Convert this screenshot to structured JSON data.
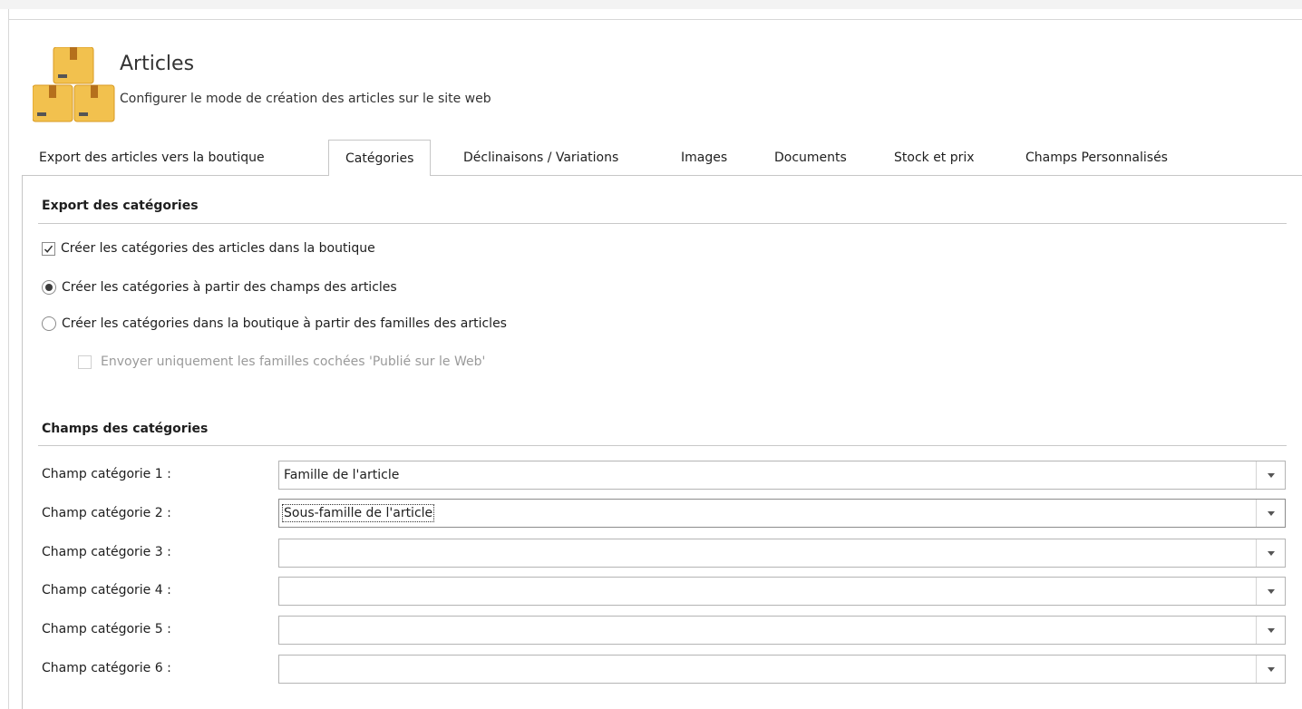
{
  "header": {
    "title": "Articles",
    "subtitle": "Configurer le mode de création des articles sur le site web",
    "icon": "boxes-icon"
  },
  "tabs": [
    {
      "label": "Export des articles vers la boutique",
      "active": false
    },
    {
      "label": "Catégories",
      "active": true
    },
    {
      "label": "Déclinaisons / Variations",
      "active": false
    },
    {
      "label": "Images",
      "active": false
    },
    {
      "label": "Documents",
      "active": false
    },
    {
      "label": "Stock et prix",
      "active": false
    },
    {
      "label": "Champs Personnalisés",
      "active": false
    }
  ],
  "export_section": {
    "title": "Export des catégories",
    "create_categories": {
      "label": "Créer les catégories des articles dans la boutique",
      "checked": true
    },
    "mode_fields": {
      "label": "Créer les catégories à partir des champs des articles",
      "selected": true
    },
    "mode_families": {
      "label": "Créer les catégories dans la boutique à partir des familles des articles",
      "selected": false
    },
    "only_published": {
      "label": "Envoyer uniquement les familles cochées 'Publié sur le Web'",
      "checked": false,
      "enabled": false
    }
  },
  "fields_section": {
    "title": "Champs des catégories",
    "fields": [
      {
        "label": "Champ catégorie 1 :",
        "value": "Famille de l'article"
      },
      {
        "label": "Champ catégorie 2 :",
        "value": "Sous-famille de l'article"
      },
      {
        "label": "Champ catégorie 3 :",
        "value": ""
      },
      {
        "label": "Champ catégorie 4 :",
        "value": ""
      },
      {
        "label": "Champ catégorie 5 :",
        "value": ""
      },
      {
        "label": "Champ catégorie 6 :",
        "value": ""
      }
    ]
  },
  "colors": {
    "icon_box": "#f2c14e",
    "icon_box_shade": "#d99a22",
    "tab_border": "#c6c6c6"
  }
}
